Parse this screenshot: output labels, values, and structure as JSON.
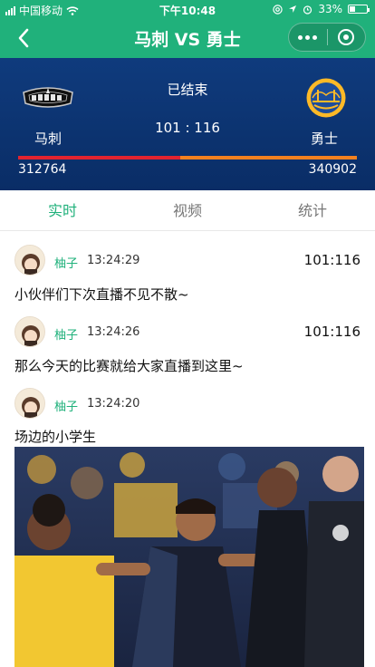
{
  "status_bar": {
    "carrier": "中国移动",
    "time": "下午10:48",
    "battery": "33%",
    "battery_level": 0.33
  },
  "nav": {
    "title": "马刺 VS 勇士",
    "back_icon": "chevron-left-icon",
    "more_icon": "more-dots-icon",
    "close_icon": "target-close-icon"
  },
  "game": {
    "status": "已结束",
    "score": "101 : 116",
    "home": {
      "name": "马刺",
      "support": "312764",
      "color": "#e3232f"
    },
    "away": {
      "name": "勇士",
      "support": "340902",
      "color": "#f4811f"
    },
    "home_share": 0.478
  },
  "tabs": [
    {
      "label": "实时",
      "active": true
    },
    {
      "label": "视频",
      "active": false
    },
    {
      "label": "统计",
      "active": false
    }
  ],
  "feed": [
    {
      "user": "柚子",
      "time": "13:24:29",
      "score": "101:116",
      "text": "小伙伴们下次直播不见不散~"
    },
    {
      "user": "柚子",
      "time": "13:24:26",
      "score": "101:116",
      "text": "那么今天的比赛就给大家直播到这里~"
    },
    {
      "user": "柚子",
      "time": "13:24:20",
      "score": "",
      "text": "场边的小学生"
    }
  ],
  "colors": {
    "accent": "#20b17b",
    "board": "#0f3b7d"
  }
}
